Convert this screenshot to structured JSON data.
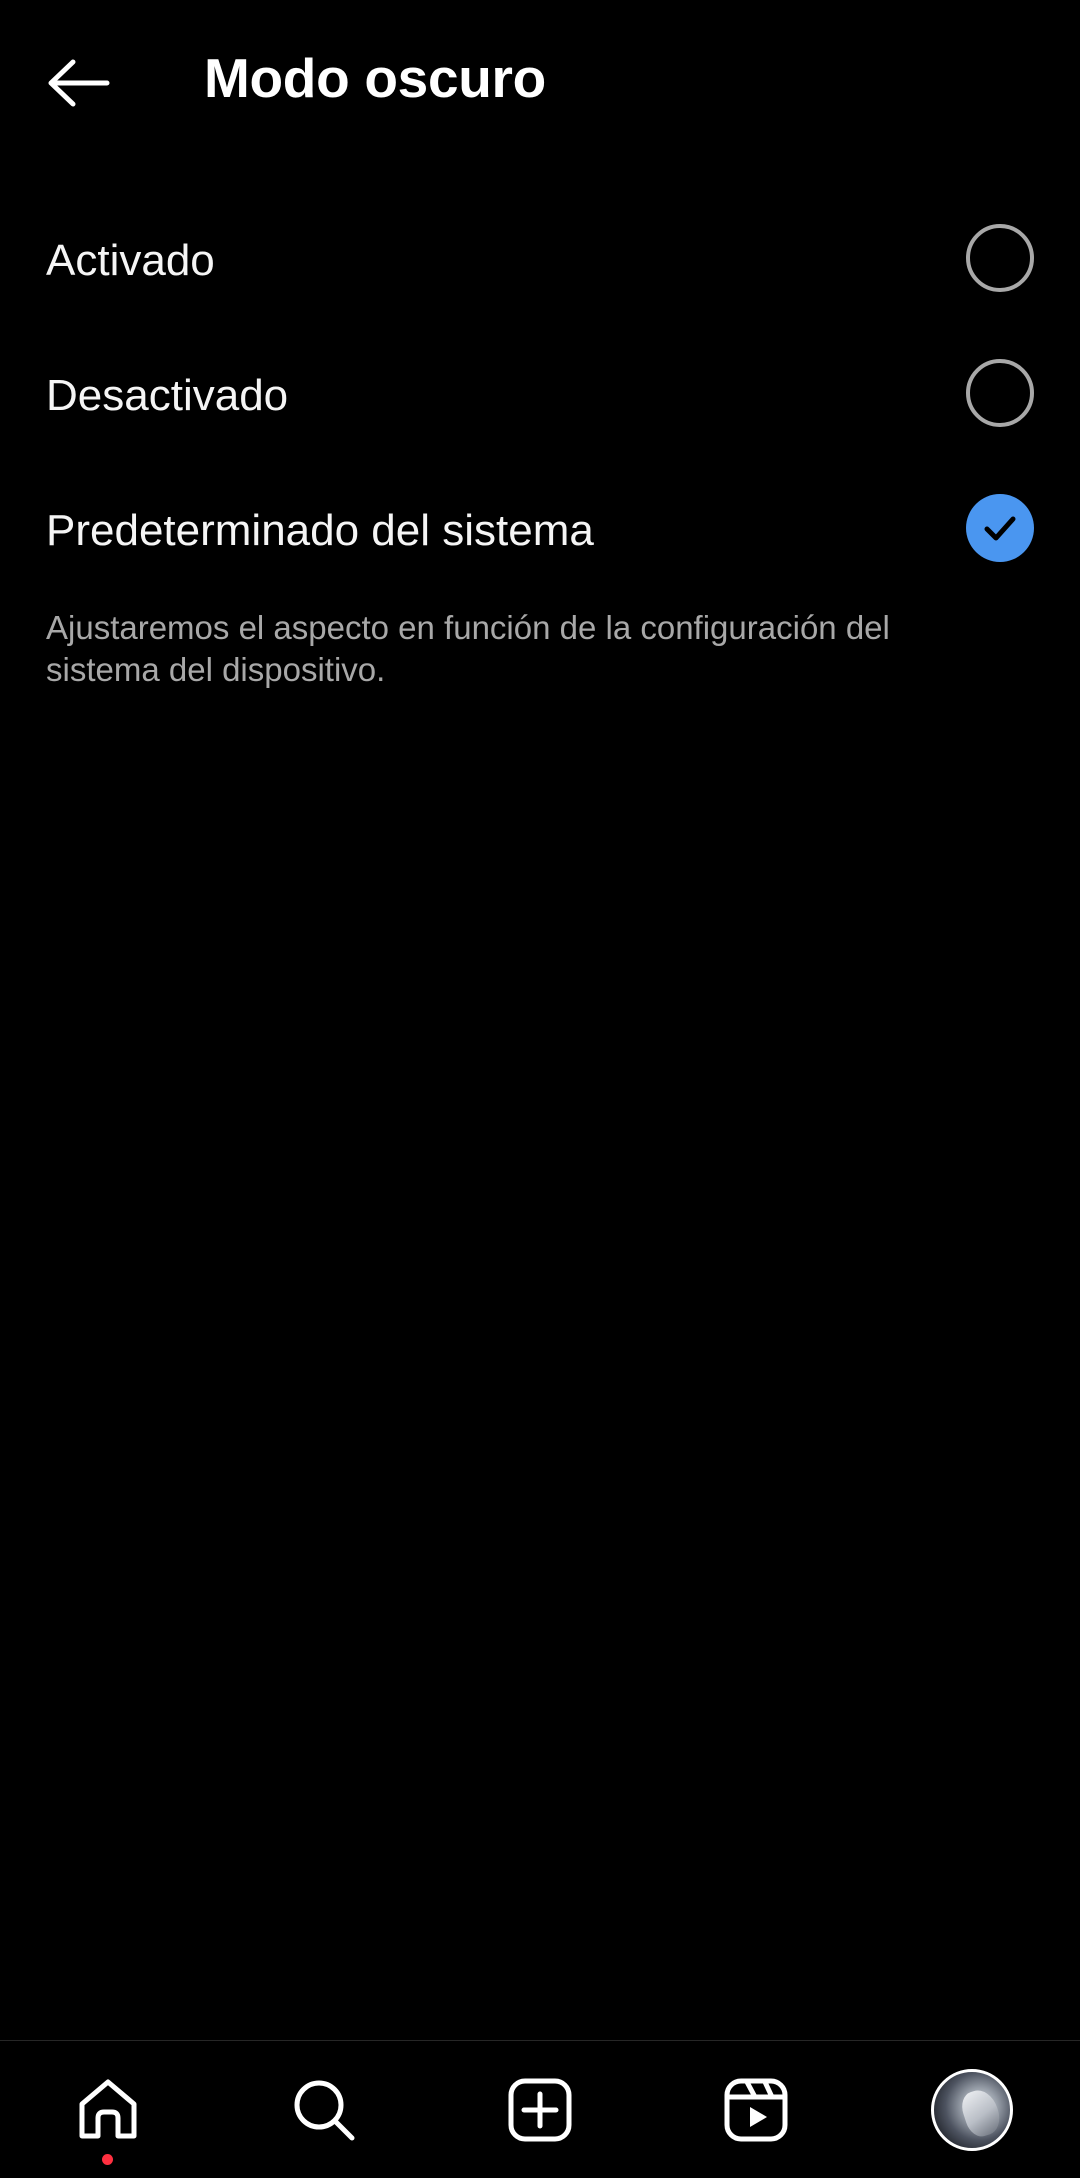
{
  "header": {
    "title": "Modo oscuro",
    "back_icon": "arrow-left-icon"
  },
  "options": [
    {
      "label": "Activado",
      "selected": false
    },
    {
      "label": "Desactivado",
      "selected": false
    },
    {
      "label": "Predeterminado del sistema",
      "selected": true
    }
  ],
  "description": "Ajustaremos el aspecto en función de la configuración del sistema del dispositivo.",
  "bottom_nav": {
    "items": [
      {
        "icon": "home-icon",
        "active": true,
        "notification_dot": true
      },
      {
        "icon": "search-icon",
        "active": false
      },
      {
        "icon": "create-post-icon",
        "active": false
      },
      {
        "icon": "reels-icon",
        "active": false
      },
      {
        "icon": "profile-avatar",
        "active": false
      }
    ]
  },
  "colors": {
    "background": "#000000",
    "text": "#f5f5f5",
    "secondary_text": "#a8a8a8",
    "radio_border": "#a8a8a8",
    "accent": "#4a96f0",
    "notification": "#ff3040",
    "divider": "#262626"
  }
}
